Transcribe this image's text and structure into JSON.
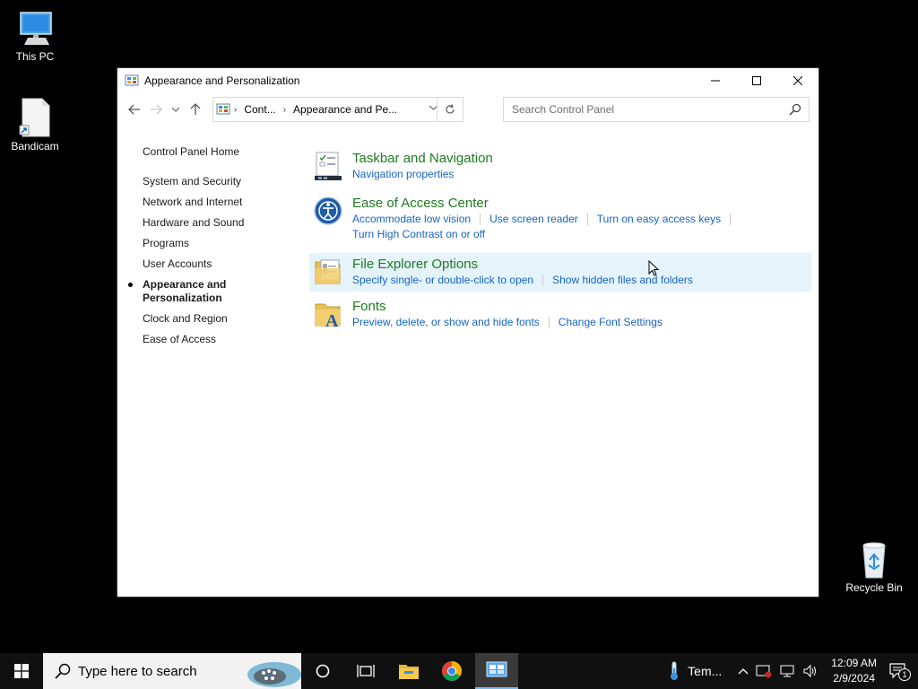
{
  "desktop": {
    "icons": [
      {
        "label": "This PC"
      },
      {
        "label": "Bandicam"
      },
      {
        "label": "Recycle Bin"
      }
    ]
  },
  "window": {
    "title": "Appearance and Personalization",
    "address": {
      "crumbs": [
        "Cont...",
        "Appearance and Pe..."
      ]
    },
    "search": {
      "placeholder": "Search Control Panel",
      "value": ""
    },
    "leftnav": {
      "home": "Control Panel Home",
      "items": [
        "System and Security",
        "Network and Internet",
        "Hardware and Sound",
        "Programs",
        "User Accounts",
        "Appearance and Personalization",
        "Clock and Region",
        "Ease of Access"
      ],
      "current_index": 5
    },
    "categories": [
      {
        "title": "Taskbar and Navigation",
        "icon": "taskbar-icon",
        "links": [
          "Navigation properties"
        ]
      },
      {
        "title": "Ease of Access Center",
        "icon": "ease-of-access-icon",
        "links": [
          "Accommodate low vision",
          "Use screen reader",
          "Turn on easy access keys",
          "Turn High Contrast on or off"
        ]
      },
      {
        "title": "File Explorer Options",
        "icon": "file-explorer-options-icon",
        "links": [
          "Specify single- or double-click to open",
          "Show hidden files and folders"
        ]
      },
      {
        "title": "Fonts",
        "icon": "fonts-icon",
        "links": [
          "Preview, delete, or show and hide fonts",
          "Change Font Settings"
        ]
      }
    ]
  },
  "taskbar": {
    "search_placeholder": "Type here to search",
    "weather_label": "Tem...",
    "time": "12:09 AM",
    "date": "2/9/2024",
    "notification_count": "1"
  },
  "colors": {
    "category_title": "#1e7b1e",
    "link": "#1565c0",
    "hover_bg": "#e5f3fb",
    "taskbar_bg": "#101010"
  }
}
